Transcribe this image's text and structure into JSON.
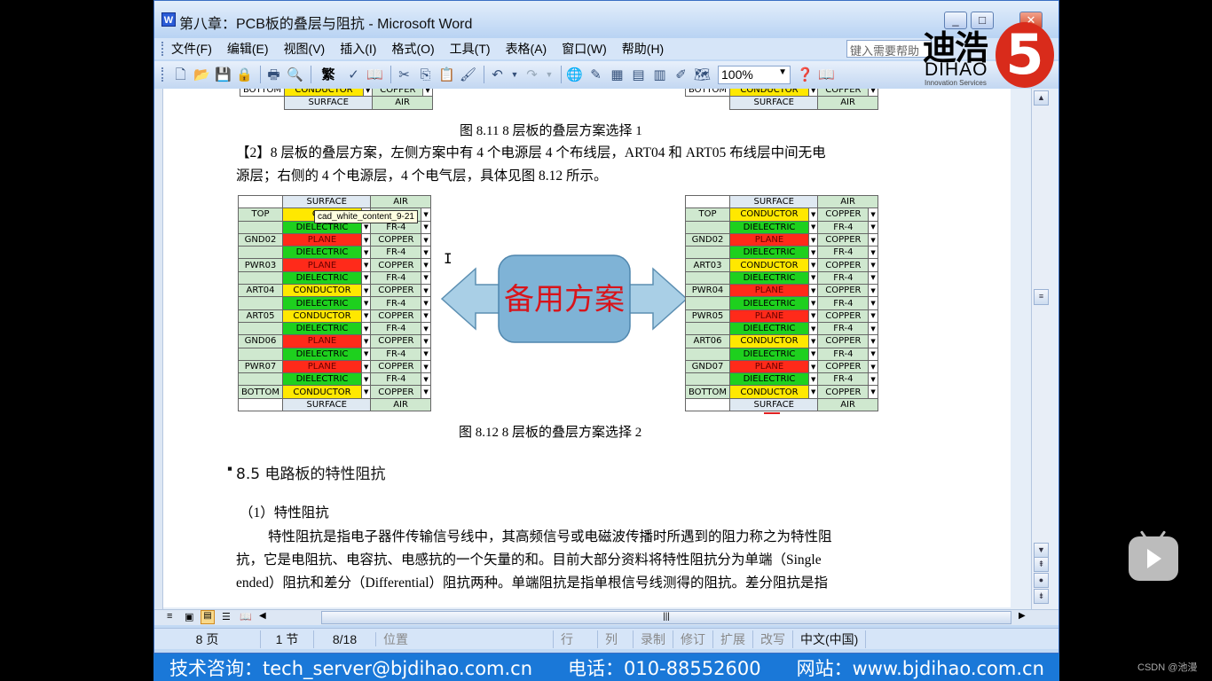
{
  "window": {
    "title": "第八章：PCB板的叠层与阻抗 - Microsoft Word",
    "app_icon": "W"
  },
  "logo": {
    "cn": "迪浩",
    "en": "DIHAO",
    "sub": "Innovation Services",
    "mark": "5"
  },
  "menu": [
    "文件(F)",
    "编辑(E)",
    "视图(V)",
    "插入(I)",
    "格式(O)",
    "工具(T)",
    "表格(A)",
    "窗口(W)",
    "帮助(H)"
  ],
  "help_placeholder": "键入需要帮助",
  "toolbar": {
    "zoom": "100%",
    "font_glyph": "繁"
  },
  "doc": {
    "fig811_caption": "图 8.11    8 层板的叠层方案选择 1",
    "fig811_partial_left": [
      "BOTTOM",
      "CONDUCTOR",
      "COPPER"
    ],
    "fig811_partial_bottom": [
      "SURFACE",
      "AIR"
    ],
    "para2_line1": "【2】8 层板的叠层方案，左侧方案中有 4 个电源层 4 个布线层，ART04 和 ART05 布线层中间无电",
    "para2_line2": "源层；右侧的 4 个电源层，4 个电气层，具体见图 8.12 所示。",
    "arrow_label": "备用方案",
    "tooltip": "cad_white_content_9-21",
    "fig812_caption": "图 8.12    8 层板的叠层方案选择 2",
    "heading": "8.5  电路板的特性阻抗",
    "subheading": "（1）特性阻抗",
    "body_line1": "特性阻抗是指电子器件传输信号线中，其高频信号或电磁波传播时所遇到的阻力称之为特性阻",
    "body_line2": "抗，它是电阻抗、电容抗、电感抗的一个矢量的和。目前大部分资料将特性阻抗分为单端（Single",
    "body_line3": "ended）阻抗和差分（Differential）阻抗两种。单端阻抗是指单根信号线测得的阻抗。差分阻抗是指"
  },
  "stackup_left": {
    "header": [
      "SURFACE",
      "AIR"
    ],
    "footer": [
      "SURFACE",
      "AIR"
    ],
    "rows": [
      {
        "label": "TOP",
        "type": "cond",
        "mat": "CON",
        "cu": "R"
      },
      {
        "label": "",
        "type": "diel",
        "mat": "DIELECTRIC",
        "cu": "FR-4"
      },
      {
        "label": "GND02",
        "type": "plan",
        "mat": "PLANE",
        "cu": "COPPER"
      },
      {
        "label": "",
        "type": "diel",
        "mat": "DIELECTRIC",
        "cu": "FR-4"
      },
      {
        "label": "PWR03",
        "type": "plan",
        "mat": "PLANE",
        "cu": "COPPER"
      },
      {
        "label": "",
        "type": "diel",
        "mat": "DIELECTRIC",
        "cu": "FR-4"
      },
      {
        "label": "ART04",
        "type": "cond",
        "mat": "CONDUCTOR",
        "cu": "COPPER"
      },
      {
        "label": "",
        "type": "diel",
        "mat": "DIELECTRIC",
        "cu": "FR-4"
      },
      {
        "label": "ART05",
        "type": "cond",
        "mat": "CONDUCTOR",
        "cu": "COPPER"
      },
      {
        "label": "",
        "type": "diel",
        "mat": "DIELECTRIC",
        "cu": "FR-4"
      },
      {
        "label": "GND06",
        "type": "plan",
        "mat": "PLANE",
        "cu": "COPPER"
      },
      {
        "label": "",
        "type": "diel",
        "mat": "DIELECTRIC",
        "cu": "FR-4"
      },
      {
        "label": "PWR07",
        "type": "plan",
        "mat": "PLANE",
        "cu": "COPPER"
      },
      {
        "label": "",
        "type": "diel",
        "mat": "DIELECTRIC",
        "cu": "FR-4"
      },
      {
        "label": "BOTTOM",
        "type": "cond",
        "mat": "CONDUCTOR",
        "cu": "COPPER"
      }
    ]
  },
  "stackup_right": {
    "header": [
      "SURFACE",
      "AIR"
    ],
    "footer": [
      "SURFACE",
      "AIR"
    ],
    "rows": [
      {
        "label": "TOP",
        "type": "cond",
        "mat": "CONDUCTOR",
        "cu": "COPPER"
      },
      {
        "label": "",
        "type": "diel",
        "mat": "DIELECTRIC",
        "cu": "FR-4"
      },
      {
        "label": "GND02",
        "type": "plan",
        "mat": "PLANE",
        "cu": "COPPER"
      },
      {
        "label": "",
        "type": "diel",
        "mat": "DIELECTRIC",
        "cu": "FR-4"
      },
      {
        "label": "ART03",
        "type": "cond",
        "mat": "CONDUCTOR",
        "cu": "COPPER"
      },
      {
        "label": "",
        "type": "diel",
        "mat": "DIELECTRIC",
        "cu": "FR-4"
      },
      {
        "label": "PWR04",
        "type": "plan",
        "mat": "PLANE",
        "cu": "COPPER"
      },
      {
        "label": "",
        "type": "diel",
        "mat": "DIELECTRIC",
        "cu": "FR-4"
      },
      {
        "label": "PWR05",
        "type": "plan",
        "mat": "PLANE",
        "cu": "COPPER"
      },
      {
        "label": "",
        "type": "diel",
        "mat": "DIELECTRIC",
        "cu": "FR-4"
      },
      {
        "label": "ART06",
        "type": "cond",
        "mat": "CONDUCTOR",
        "cu": "COPPER"
      },
      {
        "label": "",
        "type": "diel",
        "mat": "DIELECTRIC",
        "cu": "FR-4"
      },
      {
        "label": "GND07",
        "type": "plan",
        "mat": "PLANE",
        "cu": "COPPER"
      },
      {
        "label": "",
        "type": "diel",
        "mat": "DIELECTRIC",
        "cu": "FR-4"
      },
      {
        "label": "BOTTOM",
        "type": "cond",
        "mat": "CONDUCTOR",
        "cu": "COPPER"
      }
    ]
  },
  "status": {
    "page": "8 页",
    "section": "1 节",
    "pages": "8/18",
    "position": "位置",
    "line": "行",
    "col": "列",
    "rec": "录制",
    "trk": "修订",
    "ext": "扩展",
    "ovr": "改写",
    "lang": "中文(中国)"
  },
  "banner": {
    "support": "技术咨询：tech_server@bjdihao.com.cn",
    "phone": "电话：010-88552600",
    "site": "网站：www.bjdihao.com.cn"
  },
  "watermark": "CSDN @池漫",
  "colors": {
    "conductor": "#ffe800",
    "dielectric": "#1ed01e",
    "plane": "#ff2a1a",
    "banner": "#1a78d8",
    "arrow_box": "#7fb3d6"
  }
}
